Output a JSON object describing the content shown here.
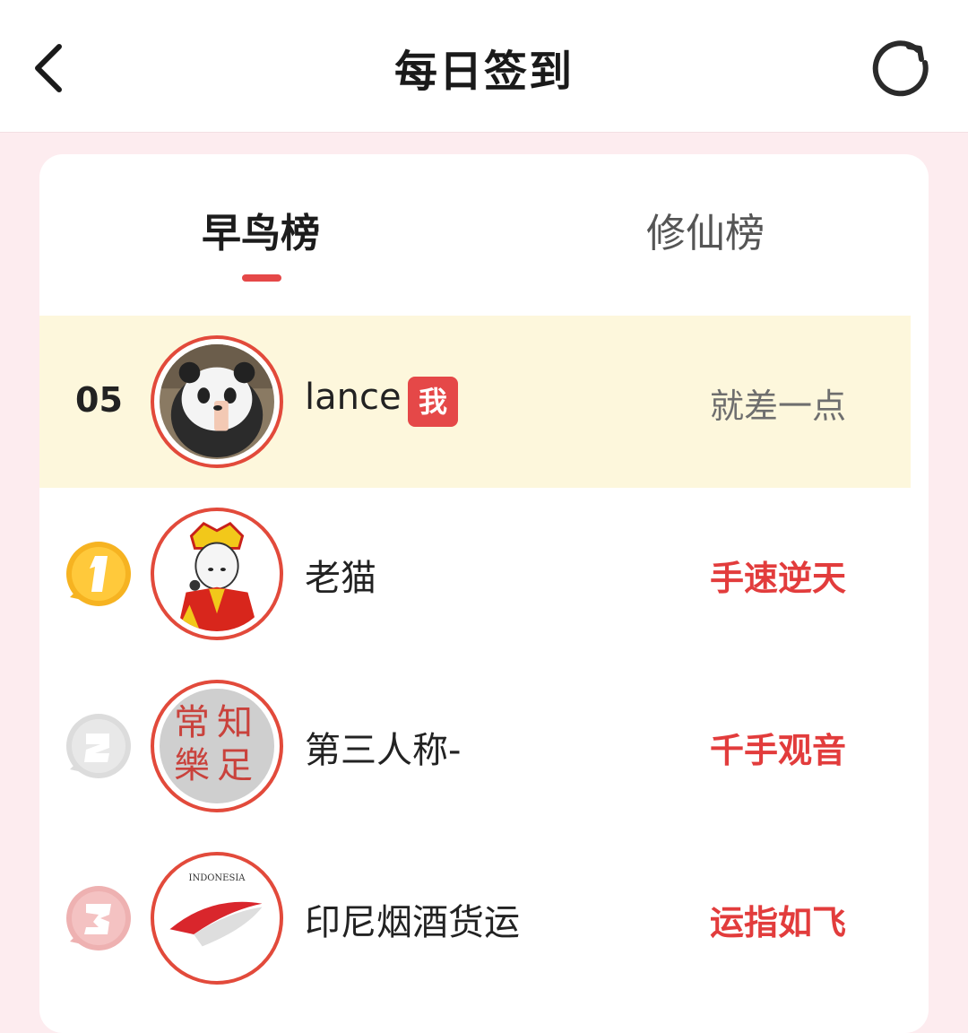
{
  "header": {
    "title": "每日签到"
  },
  "tabs": [
    {
      "label": "早鸟榜",
      "active": true
    },
    {
      "label": "修仙榜",
      "active": false
    }
  ],
  "my_entry": {
    "rank": "05",
    "name": "lance",
    "me_badge": "我",
    "status": "就差一点"
  },
  "leaderboard": [
    {
      "rank": 1,
      "name": "老猫",
      "status": "手速逆天",
      "medal_color": "#f6b321"
    },
    {
      "rank": 2,
      "name": "第三人称-",
      "status": "千手观音",
      "medal_color": "#d8d8d8"
    },
    {
      "rank": 3,
      "name": "印尼烟酒货运",
      "status": "运指如飞",
      "medal_color": "#f1b7b7"
    }
  ],
  "avatar_texts": {
    "rank2": [
      "常",
      "知",
      "樂",
      "足"
    ],
    "rank3": "INDONESIA"
  },
  "colors": {
    "accent": "#e54848",
    "my_row_bg": "#fdf7dc",
    "page_bg": "#fdecef"
  }
}
